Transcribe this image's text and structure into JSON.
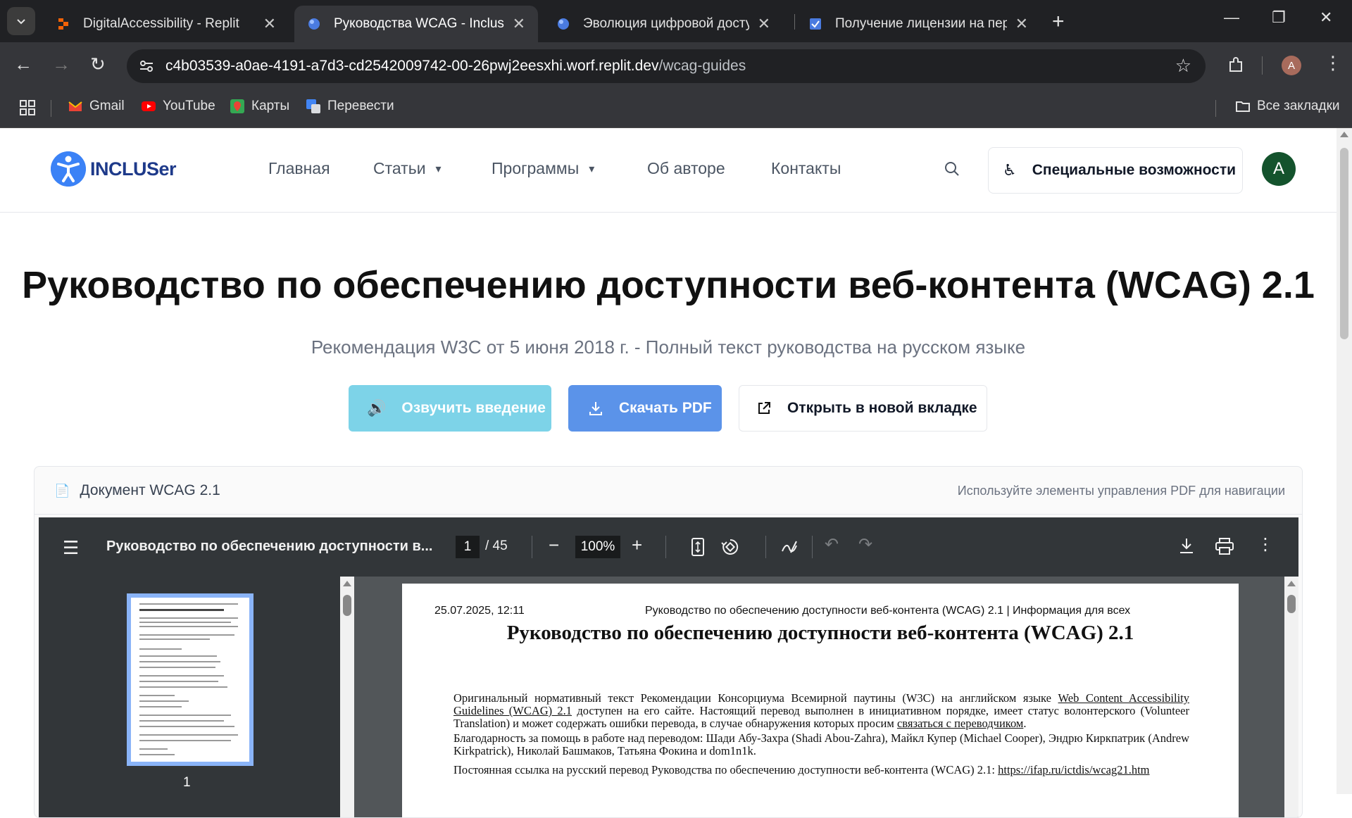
{
  "browser": {
    "tabs": [
      {
        "title": "DigitalAccessibility - Replit",
        "active": false
      },
      {
        "title": "Руководства WCAG - Incluser",
        "active": true
      },
      {
        "title": "Эволюция цифровой доступно",
        "active": false
      },
      {
        "title": "Получение лицензии на перев",
        "active": false
      }
    ],
    "url_host": "c4b03539-a0ae-4191-a7d3-cd2542009742-00-26pwj2eesxhi.worf.replit.dev",
    "url_path": "/wcag-guides",
    "profile_initial": "A",
    "bookmarks": [
      "Gmail",
      "YouTube",
      "Карты",
      "Перевести"
    ],
    "all_bookmarks": "Все закладки"
  },
  "site": {
    "logo_text": "INCLUSer",
    "nav": [
      "Главная",
      "Статьи",
      "Программы",
      "Об авторе",
      "Контакты"
    ],
    "accessibility_button": "Специальные возможности",
    "user_initial": "A"
  },
  "hero": {
    "title": "Руководство по обеспечению доступности веб-контента (WCAG) 2.1",
    "subtitle": "Рекомендация W3C от 5 июня 2018 г. - Полный текст руководства на русском языке",
    "btn_listen": "Озвучить введение",
    "btn_pdf": "Скачать PDF",
    "btn_open": "Открыть в новой вкладке"
  },
  "doc": {
    "title": "Документ WCAG 2.1",
    "hint": "Используйте элементы управления PDF для навигации"
  },
  "pdf": {
    "title": "Руководство по обеспечению доступности в...",
    "page_current": "1",
    "page_total": "/ 45",
    "zoom": "100%",
    "thumb_number": "1",
    "page_date": "25.07.2025, 12:11",
    "page_header": "Руководство по обеспечению доступности веб-контента (WCAG) 2.1 | Информация для всех",
    "page_title": "Руководство по обеспечению доступности веб-контента (WCAG) 2.1",
    "para1_a": "Оригинальный нормативный текст Рекомендации Консорциума Всемирной паутины (W3C) на английском языке ",
    "para1_link": "Web Content Accessibility Guidelines (WCAG) 2.1",
    "para1_b": " доступен на его сайте. Настоящий перевод выполнен в инициативном порядке, имеет статус волонтерского (Volunteer Translation) и может содержать ошибки перевода, в случае обнаружения которых просим ",
    "para1_link2": "связаться с переводчиком",
    "para1_c": ".",
    "para2": "Благодарность за помощь в работе над переводом: Шади Абу-Захра (Shadi Abou-Zahra), Майкл Купер (Michael Cooper), Эндрю Киркпатрик (Andrew Kirkpatrick), Николай Башмаков, Татьяна Фокина и dom1n1k.",
    "para3_a": "Постоянная ссылка на русский перевод Руководства по обеспечению доступности веб-контента (WCAG) 2.1: ",
    "para3_link": "https://ifap.ru/ictdis/wcag21.htm"
  }
}
